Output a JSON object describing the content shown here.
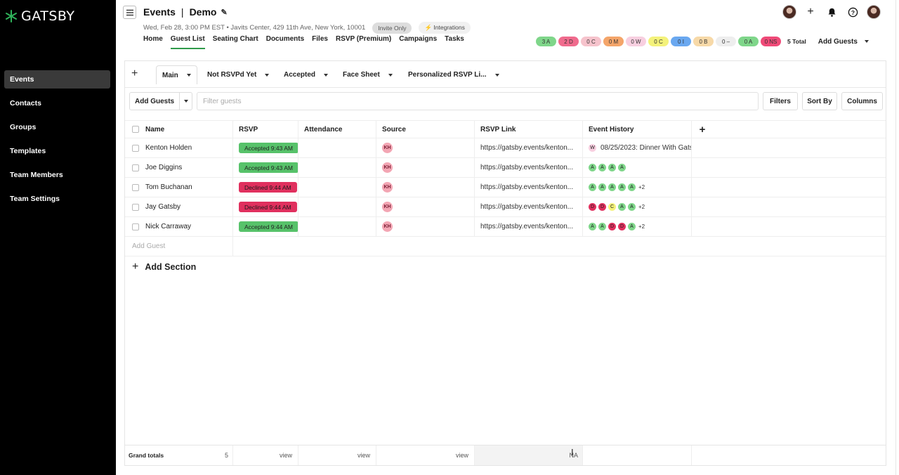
{
  "brand": {
    "name": "GATSBY"
  },
  "sidebar": {
    "items": [
      {
        "label": "Events",
        "active": true
      },
      {
        "label": "Contacts"
      },
      {
        "label": "Groups"
      },
      {
        "label": "Templates"
      },
      {
        "label": "Team Members"
      },
      {
        "label": "Team Settings"
      }
    ]
  },
  "header": {
    "section": "Events",
    "separator": "|",
    "event_name": "Demo",
    "subtitle": "Wed, Feb 28, 3:00 PM EST • Javits Center, 429 11th Ave, New York, 10001",
    "invite_chip": "Invite Only",
    "integrations_chip": "⚡ Integrations"
  },
  "tabs": [
    "Home",
    "Guest List",
    "Seating Chart",
    "Documents",
    "Files",
    "RSVP (Premium)",
    "Campaigns",
    "Tasks"
  ],
  "status_pills": [
    {
      "label": "3 A",
      "color": "#7fd68a"
    },
    {
      "label": "2 D",
      "color": "#f06b8d"
    },
    {
      "label": "0 C",
      "color": "#f6c3cc"
    },
    {
      "label": "0 M",
      "color": "#f4a56a"
    },
    {
      "label": "0 W",
      "color": "#f8cfe0"
    },
    {
      "label": "0 C",
      "color": "#f4f27a"
    },
    {
      "label": "0 I",
      "color": "#6aa8f0"
    },
    {
      "label": "0 B",
      "color": "#f7d9a8"
    },
    {
      "label": "0 –",
      "color": "#eeeeee"
    },
    {
      "label": "0 A",
      "color": "#7fd68a"
    },
    {
      "label": "0 NS",
      "color": "#f04a78"
    }
  ],
  "total_label": "5 Total",
  "add_guests_top": "Add Guests",
  "views": [
    {
      "label": "Main",
      "active": true
    },
    {
      "label": "Not RSVPd Yet"
    },
    {
      "label": "Accepted"
    },
    {
      "label": "Face Sheet"
    },
    {
      "label": "Personalized RSVP Li..."
    }
  ],
  "toolbar": {
    "add_guests": "Add Guests",
    "filter_placeholder": "Filter guests",
    "filters": "Filters",
    "sort_by": "Sort By",
    "columns": "Columns"
  },
  "columns": [
    "Name",
    "RSVP",
    "Attendance",
    "Source",
    "RSVP Link",
    "Event History"
  ],
  "rows": [
    {
      "name": "Kenton Holden",
      "rsvp": "Accepted 9:43 AM",
      "rsvp_status": "accepted",
      "source": "KH",
      "link": "https://gatsby.events/kenton...",
      "history_text": "08/25/2023: Dinner With Gats",
      "history": [
        {
          "l": "W",
          "c": "#f8cfe0"
        }
      ],
      "more": ""
    },
    {
      "name": "Joe Diggins",
      "rsvp": "Accepted 9:43 AM",
      "rsvp_status": "accepted",
      "source": "KH",
      "link": "https://gatsby.events/kenton...",
      "history_text": "",
      "history": [
        {
          "l": "A",
          "c": "#7fd68a"
        },
        {
          "l": "A",
          "c": "#7fd68a"
        },
        {
          "l": "A",
          "c": "#7fd68a"
        },
        {
          "l": "A",
          "c": "#7fd68a"
        }
      ],
      "more": ""
    },
    {
      "name": "Tom Buchanan",
      "rsvp": "Declined 9:44 AM",
      "rsvp_status": "declined",
      "source": "KH",
      "link": "https://gatsby.events/kenton...",
      "history_text": "",
      "history": [
        {
          "l": "A",
          "c": "#7fd68a"
        },
        {
          "l": "A",
          "c": "#7fd68a"
        },
        {
          "l": "A",
          "c": "#7fd68a"
        },
        {
          "l": "A",
          "c": "#7fd68a"
        },
        {
          "l": "A",
          "c": "#7fd68a"
        }
      ],
      "more": "+2"
    },
    {
      "name": "Jay Gatsby",
      "rsvp": "Declined 9:44 AM",
      "rsvp_status": "declined",
      "source": "KH",
      "link": "https://gatsby.events/kenton...",
      "history_text": "",
      "history": [
        {
          "l": "D",
          "c": "#e0305e"
        },
        {
          "l": "D",
          "c": "#e0305e"
        },
        {
          "l": "C",
          "c": "#f4f27a"
        },
        {
          "l": "A",
          "c": "#7fd68a"
        },
        {
          "l": "A",
          "c": "#7fd68a"
        }
      ],
      "more": "+2"
    },
    {
      "name": "Nick Carraway",
      "rsvp": "Accepted 9:44 AM",
      "rsvp_status": "accepted",
      "source": "KH",
      "link": "https://gatsby.events/kenton...",
      "history_text": "",
      "history": [
        {
          "l": "A",
          "c": "#7fd68a"
        },
        {
          "l": "A",
          "c": "#7fd68a"
        },
        {
          "l": "D",
          "c": "#e0305e"
        },
        {
          "l": "D",
          "c": "#e0305e"
        },
        {
          "l": "A",
          "c": "#7fd68a"
        }
      ],
      "more": "+2"
    }
  ],
  "add_guest_placeholder": "Add Guest",
  "add_section": "Add Section",
  "totals": {
    "label": "Grand totals",
    "count": "5",
    "rsvp": "view",
    "attendance": "view",
    "source": "view",
    "link": "NA"
  }
}
